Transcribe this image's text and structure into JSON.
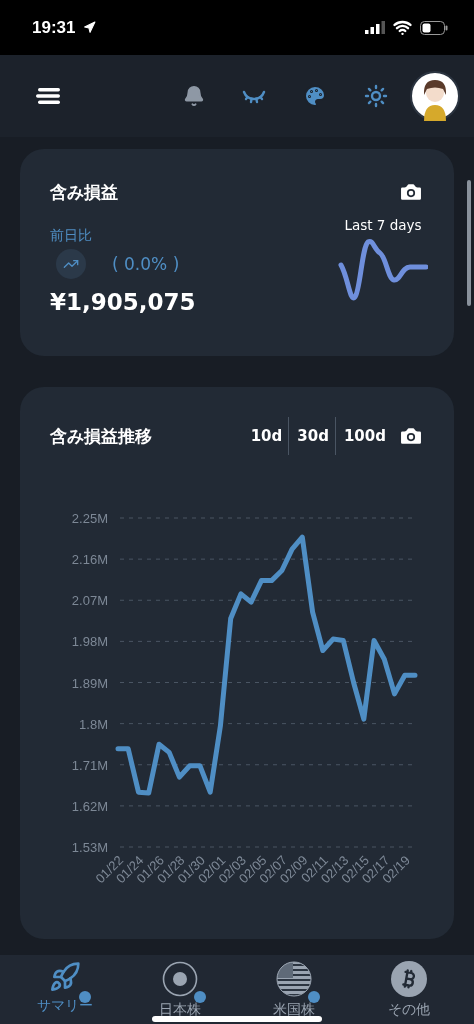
{
  "status_bar": {
    "time": "19:31"
  },
  "summary_card": {
    "title": "含み損益",
    "comparison_label": "前日比",
    "change": "( 0.0% )",
    "amount": "¥1,905,075",
    "sparkline_label": "Last 7 days"
  },
  "trend_card": {
    "title": "含み損益推移",
    "ranges": [
      {
        "label": "10d"
      },
      {
        "label": "30d"
      },
      {
        "label": "100d"
      }
    ],
    "chart_data": {
      "type": "line",
      "categories": [
        "01/22",
        null,
        "01/24",
        null,
        "01/26",
        null,
        "01/28",
        null,
        "01/30",
        null,
        "02/01",
        null,
        "02/03",
        null,
        "02/05",
        null,
        "02/07",
        null,
        "02/09",
        null,
        "02/11",
        null,
        "02/13",
        null,
        "02/15",
        null,
        "02/17",
        null,
        "02/19",
        null
      ],
      "grid": true,
      "series": [
        {
          "color": "#4f8ec4",
          "values": [
            1.745,
            1.745,
            1.65,
            1.648,
            1.755,
            1.737,
            1.683,
            1.708,
            1.708,
            1.65,
            1.795,
            2.03,
            2.084,
            2.066,
            2.113,
            2.113,
            2.135,
            2.182,
            2.208,
            2.044,
            1.96,
            1.985,
            1.982,
            1.89,
            1.81,
            1.982,
            1.941,
            1.865,
            1.906,
            1.906
          ]
        }
      ],
      "ylim": [
        1.53,
        2.25
      ],
      "yticks": [
        {
          "value": 1.53,
          "label": "1.53M"
        },
        {
          "value": 1.62,
          "label": "1.62M"
        },
        {
          "value": 1.71,
          "label": "1.71M"
        },
        {
          "value": 1.8,
          "label": "1.8M"
        },
        {
          "value": 1.89,
          "label": "1.89M"
        },
        {
          "value": 1.98,
          "label": "1.98M"
        },
        {
          "value": 2.07,
          "label": "2.07M"
        },
        {
          "value": 2.16,
          "label": "2.16M"
        },
        {
          "value": 2.25,
          "label": "2.25M"
        }
      ]
    }
  },
  "tab_bar": {
    "items": [
      {
        "kind": "rocket",
        "label": "サマリー",
        "selected": true
      },
      {
        "kind": "circle",
        "label": "日本株",
        "selected": false
      },
      {
        "kind": "flag",
        "label": "米国株",
        "selected": false
      },
      {
        "kind": "bitcoin",
        "label": "その他",
        "selected": false
      }
    ]
  }
}
